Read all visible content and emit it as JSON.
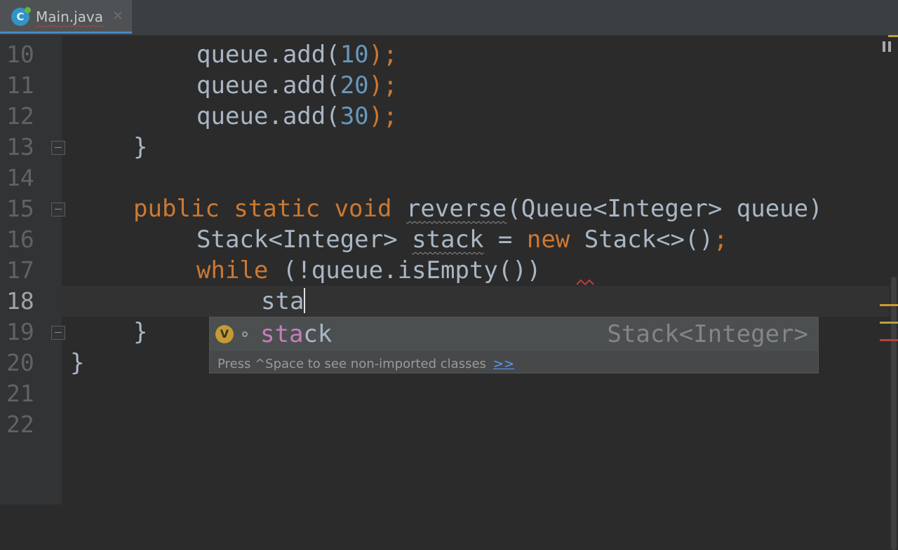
{
  "tab": {
    "icon_letter": "C",
    "label": "Main.java",
    "close_glyph": "✕"
  },
  "gutter": {
    "line_numbers": [
      "10",
      "11",
      "12",
      "13",
      "14",
      "15",
      "16",
      "17",
      "18",
      "19",
      "20",
      "21",
      "22"
    ],
    "current_line": "18"
  },
  "code": {
    "line10": {
      "obj": "queue.add(",
      "num": "10",
      "end": ");"
    },
    "line11": {
      "obj": "queue.add(",
      "num": "20",
      "end": ");"
    },
    "line12": {
      "obj": "queue.add(",
      "num": "30",
      "end": ");"
    },
    "line13": "}",
    "line15": {
      "kw": "public static void",
      "name": "reverse",
      "params": "(Queue<Integer> queue)"
    },
    "line16": {
      "type": "Stack<Integer>",
      "var": "stack",
      "eq": " = ",
      "kw_new": "new",
      "ctor": " Stack<>()",
      "semi": ";"
    },
    "line17": {
      "kw": "while",
      "cond": " (!queue.isEmpty())"
    },
    "line18": "sta",
    "line19": "}",
    "line20": "}"
  },
  "completion": {
    "badge": "V",
    "match": "sta",
    "rest": "ck",
    "type": "Stack<Integer>",
    "hint": "Press ^Space to see non-imported classes",
    "link": ">>"
  },
  "colors": {
    "background": "#2b2b2b",
    "keyword": "#cc7832",
    "number": "#6897bb",
    "text": "#a9b7c6",
    "match_highlight": "#c77dbb"
  }
}
